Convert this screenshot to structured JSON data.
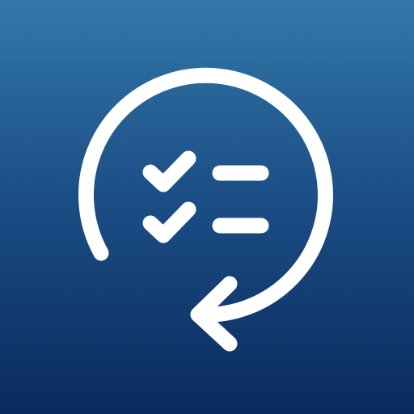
{
  "icon": {
    "kind": "app-icon",
    "subject": "recurring-checklist-icon",
    "colors": {
      "background_top": "#3378a8",
      "background_middle": "#1c5088",
      "background_bottom": "#0a2a5d",
      "foreground": "#ffffff"
    },
    "parts": [
      "circular-arrow",
      "checkmark",
      "checkmark",
      "list-line",
      "list-line"
    ]
  }
}
